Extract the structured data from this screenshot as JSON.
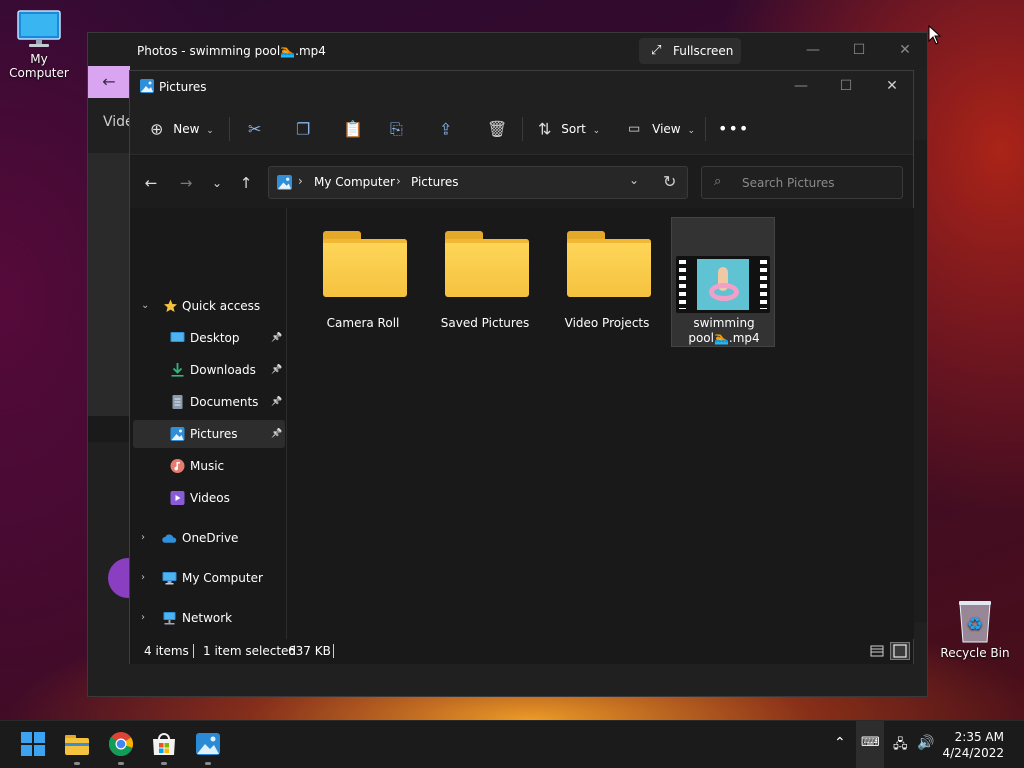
{
  "desktop": {
    "icons": [
      {
        "label": "My Computer"
      },
      {
        "label": "Recycle Bin"
      }
    ]
  },
  "photos_window": {
    "title": "Photos - swimming pool🏊.mp4",
    "fullscreen_label": "Fullscreen",
    "section_label": "Vide"
  },
  "explorer": {
    "title": "Pictures",
    "toolbar": {
      "new_label": "New",
      "sort_label": "Sort",
      "view_label": "View"
    },
    "address": {
      "crumbs": [
        "My Computer",
        "Pictures"
      ]
    },
    "search": {
      "placeholder": "Search Pictures"
    },
    "nav": {
      "quick_access": "Quick access",
      "items": [
        {
          "label": "Desktop",
          "pinned": true
        },
        {
          "label": "Downloads",
          "pinned": true
        },
        {
          "label": "Documents",
          "pinned": true
        },
        {
          "label": "Pictures",
          "pinned": true,
          "selected": true
        },
        {
          "label": "Music",
          "pinned": false
        },
        {
          "label": "Videos",
          "pinned": false
        }
      ],
      "roots": [
        {
          "label": "OneDrive"
        },
        {
          "label": "My Computer"
        },
        {
          "label": "Network"
        }
      ]
    },
    "files": [
      {
        "name": "Camera Roll",
        "type": "folder"
      },
      {
        "name": "Saved Pictures",
        "type": "folder"
      },
      {
        "name": "Video Projects",
        "type": "folder"
      },
      {
        "name_line1": "swimming",
        "name_line2": "pool🏊.mp4",
        "type": "video",
        "selected": true
      }
    ],
    "status": {
      "count": "4 items",
      "selection": "1 item selected",
      "size": "637 KB"
    }
  },
  "taskbar": {
    "apps": [
      "start-icon",
      "file-explorer-icon",
      "chrome-icon",
      "store-icon",
      "photos-icon"
    ],
    "time": "2:35 AM",
    "date": "4/24/2022"
  },
  "colors": {
    "accent": "#8ab4e8",
    "folder": "#f5c23f",
    "window_bg": "#191919",
    "photos_accent": "#d9a5f0"
  }
}
